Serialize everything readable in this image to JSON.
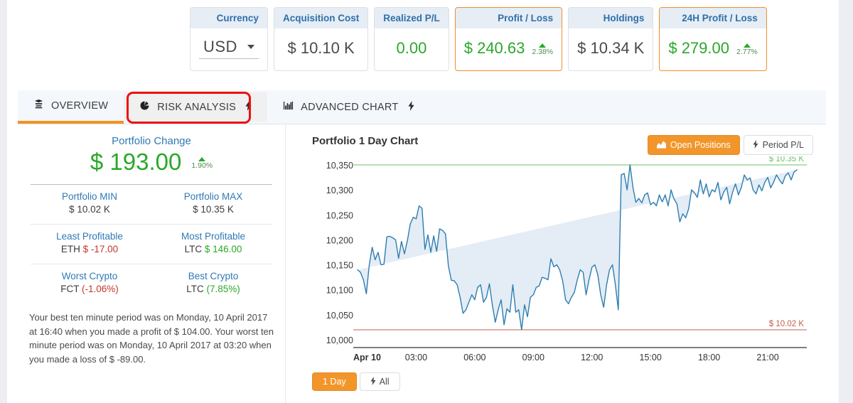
{
  "stats": [
    {
      "name": "currency",
      "header": "Currency",
      "type": "select",
      "value": "USD",
      "icon": "chevron-down-icon",
      "accent": false
    },
    {
      "name": "acquisition-cost",
      "header": "Acquisition Cost",
      "type": "value",
      "value": "$ 10.10 K",
      "value_color": "#4a4a4a",
      "accent": false
    },
    {
      "name": "realized-pl",
      "header": "Realized P/L",
      "type": "value",
      "value": "0.00",
      "value_color": "#2aa82a",
      "accent": false
    },
    {
      "name": "profit-loss",
      "header": "Profit / Loss",
      "type": "value",
      "value": "$ 240.63",
      "value_color": "#2aa82a",
      "pct": "2.38%",
      "trend": "up",
      "accent": true
    },
    {
      "name": "holdings",
      "header": "Holdings",
      "type": "value",
      "value": "$ 10.34 K",
      "value_color": "#4a4a4a",
      "accent": false
    },
    {
      "name": "24h-profit-loss",
      "header": "24H Profit / Loss",
      "type": "value",
      "value": "$ 279.00",
      "value_color": "#2aa82a",
      "pct": "2.77%",
      "trend": "up",
      "accent": true
    }
  ],
  "tabs": [
    {
      "name": "tab-overview",
      "label": "OVERVIEW",
      "icon": "layers-icon",
      "bolt": false,
      "active": true,
      "highlighted": false
    },
    {
      "name": "tab-risk-analysis",
      "label": "RISK ANALYSIS",
      "icon": "pie-chart-icon",
      "bolt": true,
      "active": false,
      "highlighted": true
    },
    {
      "name": "tab-advanced-chart",
      "label": "ADVANCED CHART",
      "icon": "bar-chart-icon",
      "bolt": true,
      "active": false,
      "highlighted": false
    }
  ],
  "bolt_glyph": "⚡",
  "left_panel": {
    "portfolio_change_label": "Portfolio Change",
    "portfolio_change_value": "$ 193.00",
    "portfolio_change_pct": "1.90%",
    "portfolio_change_trend": "up",
    "rows": [
      [
        {
          "name": "portfolio-min",
          "label": "Portfolio MIN",
          "value": "$ 10.02 K"
        },
        {
          "name": "portfolio-max",
          "label": "Portfolio MAX",
          "value": "$ 10.35 K"
        }
      ],
      [
        {
          "name": "least-profitable",
          "label": "Least Profitable",
          "value_prefix": "ETH",
          "value": "$ -17.00",
          "value_color": "#c0392b"
        },
        {
          "name": "most-profitable",
          "label": "Most Profitable",
          "value_prefix": "LTC",
          "value": "$ 146.00",
          "value_color": "#2aa82a"
        }
      ],
      [
        {
          "name": "worst-crypto",
          "label": "Worst Crypto",
          "value_prefix": "FCT",
          "value": "(-1.06%)",
          "value_color": "#c0392b"
        },
        {
          "name": "best-crypto",
          "label": "Best Crypto",
          "value_prefix": "LTC",
          "value": "(7.85%)",
          "value_color": "#2aa82a"
        }
      ]
    ],
    "description": "Your best ten minute period was on Monday, 10 April 2017 at 16:40 when you made a profit of $ 104.00. Your worst ten minute period was on Monday, 10 April 2017 at 03:20 when you made a loss of $ -89.00."
  },
  "chart_panel": {
    "title": "Portfolio 1 Day Chart",
    "buttons": [
      {
        "name": "open-positions-button",
        "label": "Open Positions",
        "icon": "area-chart-icon",
        "active": true
      },
      {
        "name": "period-pl-button",
        "label": "Period P/L",
        "icon": "bolt-icon",
        "active": false
      }
    ],
    "range_buttons": [
      {
        "name": "range-1-day-button",
        "label": "1 Day",
        "icon": "",
        "active": true
      },
      {
        "name": "range-all-button",
        "label": "All",
        "icon": "bolt-icon",
        "active": false
      }
    ]
  },
  "chart_data": {
    "type": "area",
    "title": "Portfolio 1 Day Chart",
    "xlabel": "",
    "ylabel": "",
    "ylim": [
      10000,
      10350
    ],
    "yticks": [
      "10,000",
      "10,050",
      "10,100",
      "10,150",
      "10,200",
      "10,250",
      "10,300",
      "10,350"
    ],
    "ytick_values": [
      10000,
      10050,
      10100,
      10150,
      10200,
      10250,
      10300,
      10350
    ],
    "xticks": [
      "Apr 10",
      "03:00",
      "06:00",
      "09:00",
      "12:00",
      "15:00",
      "18:00",
      "21:00"
    ],
    "xtick_values": [
      0,
      3,
      6,
      9,
      12,
      15,
      18,
      21
    ],
    "xlim": [
      0,
      23
    ],
    "grid": false,
    "legend": false,
    "line_color": "#2e7eb0",
    "fill_color": "#e4ecf5",
    "annotations": [
      {
        "name": "max-line",
        "label": "$ 10.35 K",
        "value": 10350,
        "color": "#6cbf6c"
      },
      {
        "name": "min-line",
        "label": "$ 10.02 K",
        "value": 10020,
        "color": "#c0604f"
      }
    ],
    "series": [
      {
        "name": "Portfolio Value",
        "x": [
          0.0,
          0.15,
          0.3,
          0.45,
          0.6,
          0.75,
          0.9,
          1.05,
          1.2,
          1.35,
          1.5,
          1.65,
          1.8,
          1.95,
          2.1,
          2.25,
          2.4,
          2.55,
          2.7,
          2.85,
          3.0,
          3.15,
          3.3,
          3.45,
          3.6,
          3.75,
          3.9,
          4.05,
          4.2,
          4.35,
          4.5,
          4.65,
          4.8,
          4.95,
          5.1,
          5.25,
          5.4,
          5.55,
          5.7,
          5.85,
          6.0,
          6.15,
          6.3,
          6.45,
          6.6,
          6.75,
          6.9,
          7.05,
          7.2,
          7.35,
          7.5,
          7.65,
          7.8,
          7.95,
          8.1,
          8.25,
          8.4,
          8.55,
          8.7,
          8.85,
          9.0,
          9.15,
          9.3,
          9.45,
          9.6,
          9.75,
          9.9,
          10.05,
          10.2,
          10.35,
          10.5,
          10.65,
          10.8,
          10.95,
          11.1,
          11.25,
          11.4,
          11.55,
          11.7,
          11.85,
          12.0,
          12.15,
          12.3,
          12.45,
          12.6,
          12.75,
          12.9,
          13.05,
          13.2,
          13.35,
          13.5,
          13.65,
          13.8,
          13.95,
          14.1,
          14.25,
          14.4,
          14.55,
          14.7,
          14.85,
          15.0,
          15.15,
          15.3,
          15.45,
          15.6,
          15.75,
          15.9,
          16.05,
          16.2,
          16.35,
          16.5,
          16.65,
          16.8,
          16.95,
          17.1,
          17.25,
          17.4,
          17.55,
          17.7,
          17.85,
          18.0,
          18.15,
          18.3,
          18.45,
          18.6,
          18.75,
          18.9,
          19.05,
          19.2,
          19.35,
          19.5,
          19.65,
          19.8,
          19.95,
          20.1,
          20.25,
          20.4,
          20.55,
          20.7,
          20.85,
          21.0,
          21.15,
          21.3,
          21.45,
          21.6,
          21.75,
          21.9,
          22.05,
          22.2,
          22.35,
          22.5,
          22.65,
          22.8,
          22.95,
          23.0
        ],
        "values": [
          10140,
          10135,
          10120,
          10092,
          10150,
          10185,
          10160,
          10175,
          10150,
          10151,
          10206,
          10207,
          10204,
          10200,
          10163,
          10197,
          10172,
          10198,
          10232,
          10245,
          10242,
          10268,
          10263,
          10181,
          10210,
          10175,
          10208,
          10177,
          10222,
          10219,
          10212,
          10148,
          10119,
          10118,
          10110,
          10085,
          10053,
          10060,
          10075,
          10090,
          10080,
          10105,
          10110,
          10075,
          10085,
          10112,
          10070,
          10035,
          10060,
          10080,
          10030,
          10062,
          10055,
          10110,
          10055,
          10060,
          10020,
          10070,
          10046,
          10085,
          10090,
          10105,
          10108,
          10125,
          10123,
          10120,
          10162,
          10146,
          10150,
          10140,
          10118,
          10080,
          10072,
          10085,
          10095,
          10120,
          10140,
          10135,
          10090,
          10120,
          10145,
          10150,
          10130,
          10090,
          10065,
          10110,
          10140,
          10150,
          10110,
          10060,
          10330,
          10333,
          10300,
          10350,
          10305,
          10275,
          10283,
          10274,
          10290,
          10294,
          10270,
          10275,
          10268,
          10290,
          10276,
          10290,
          10268,
          10300,
          10282,
          10272,
          10236,
          10252,
          10244,
          10262,
          10300,
          10294,
          10285,
          10320,
          10292,
          10312,
          10286,
          10300,
          10296,
          10315,
          10280,
          10296,
          10305,
          10272,
          10295,
          10312,
          10290,
          10305,
          10330,
          10320,
          10324,
          10300,
          10292,
          10310,
          10298,
          10315,
          10325,
          10304,
          10315,
          10330,
          10320,
          10312,
          10328,
          10334,
          10320,
          10336,
          10340
        ]
      }
    ]
  }
}
